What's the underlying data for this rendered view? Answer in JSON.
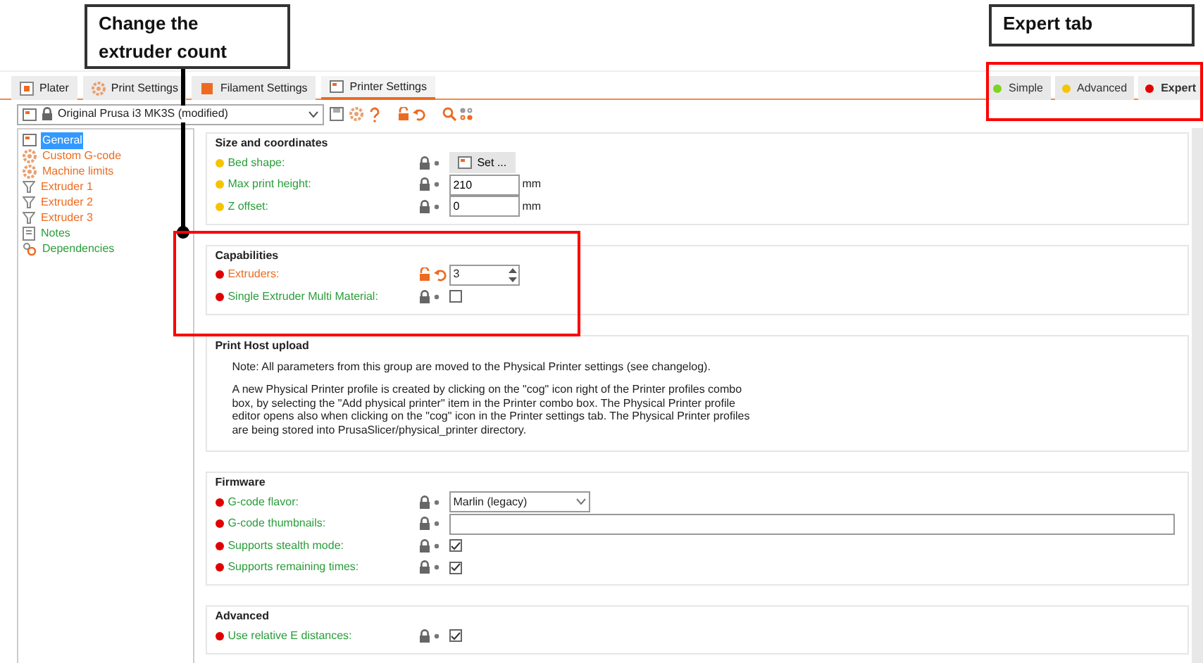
{
  "annotations": [
    {
      "text": "Change the extruder count"
    },
    {
      "text": "Expert tab"
    }
  ],
  "tabs": [
    {
      "label": "Plater",
      "selected": false
    },
    {
      "label": "Print Settings",
      "selected": false
    },
    {
      "label": "Filament Settings",
      "selected": false
    },
    {
      "label": "Printer Settings",
      "selected": true
    }
  ],
  "modes": [
    {
      "label": "Simple",
      "color": "#7ed321",
      "selected": false
    },
    {
      "label": "Advanced",
      "color": "#f5c400",
      "selected": false
    },
    {
      "label": "Expert",
      "color": "#e00000",
      "selected": true
    }
  ],
  "preset": {
    "value": "Original Prusa i3 MK3S (modified)"
  },
  "tree": [
    {
      "label": "General",
      "modified": false,
      "selected": true
    },
    {
      "label": "Custom G-code",
      "modified": true,
      "selected": false
    },
    {
      "label": "Machine limits",
      "modified": true,
      "selected": false
    },
    {
      "label": "Extruder 1",
      "modified": true,
      "selected": false
    },
    {
      "label": "Extruder 2",
      "modified": true,
      "selected": false
    },
    {
      "label": "Extruder 3",
      "modified": true,
      "selected": false
    },
    {
      "label": "Notes",
      "modified": false,
      "selected": false
    },
    {
      "label": "Dependencies",
      "modified": false,
      "selected": false
    }
  ],
  "sections": [
    {
      "title": "Size and coordinates",
      "kind": "options",
      "rows": [
        {
          "label": "Bed shape:",
          "color": "#f5c400",
          "modified": false,
          "control": {
            "kind": "button",
            "value": "Set ..."
          }
        },
        {
          "label": "Max print height:",
          "color": "#f5c400",
          "modified": false,
          "control": {
            "kind": "text",
            "value": "210",
            "unit": "mm"
          }
        },
        {
          "label": "Z offset:",
          "color": "#f5c400",
          "modified": false,
          "control": {
            "kind": "text",
            "value": "0",
            "unit": "mm"
          }
        }
      ]
    },
    {
      "title": "Capabilities",
      "kind": "options",
      "rows": [
        {
          "label": "Extruders:",
          "color": "#e00000",
          "modified": true,
          "control": {
            "kind": "spin",
            "value": "3"
          }
        },
        {
          "label": "Single Extruder Multi Material:",
          "color": "#e00000",
          "modified": false,
          "control": {
            "kind": "checkbox",
            "checked": false
          }
        }
      ]
    },
    {
      "title": "Print Host upload",
      "kind": "note",
      "paragraphs": [
        "Note: All parameters from this group are moved to the Physical Printer settings (see changelog).",
        "A new Physical Printer profile is created by clicking on the \"cog\" icon right of the Printer profiles combo box, by selecting the \"Add physical printer\" item in the Printer combo box. The Physical Printer profile editor opens also when clicking on the \"cog\" icon in the Printer settings tab. The Physical Printer profiles are being stored into PrusaSlicer/physical_printer directory."
      ]
    },
    {
      "title": "Firmware",
      "kind": "options",
      "rows": [
        {
          "label": "G-code flavor:",
          "color": "#e00000",
          "modified": false,
          "control": {
            "kind": "select",
            "value": "Marlin (legacy)"
          }
        },
        {
          "label": "G-code thumbnails:",
          "color": "#e00000",
          "modified": false,
          "control": {
            "kind": "wide"
          }
        },
        {
          "label": "Supports stealth mode:",
          "color": "#e00000",
          "modified": false,
          "control": {
            "kind": "checkbox",
            "checked": true
          }
        },
        {
          "label": "Supports remaining times:",
          "color": "#e00000",
          "modified": false,
          "control": {
            "kind": "checkbox",
            "checked": true
          }
        }
      ]
    },
    {
      "title": "Advanced",
      "kind": "options",
      "rows": [
        {
          "label": "Use relative E distances:",
          "color": "#e00000",
          "modified": false,
          "control": {
            "kind": "checkbox",
            "checked": true
          }
        }
      ]
    }
  ]
}
